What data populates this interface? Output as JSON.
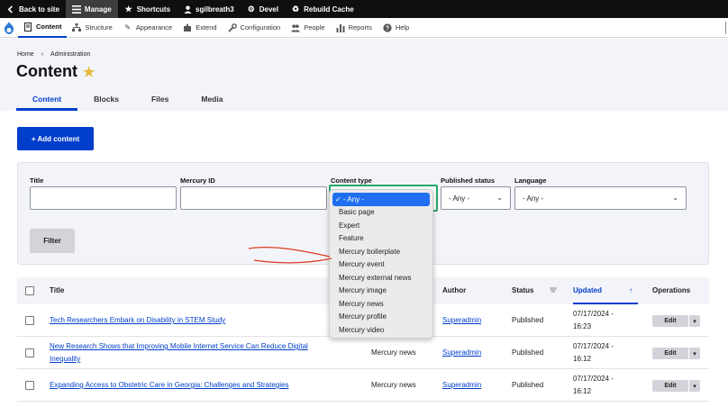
{
  "toolbar": {
    "back": "Back to site",
    "manage": "Manage",
    "shortcuts": "Shortcuts",
    "user": "sgilbreath3",
    "devel": "Devel",
    "rebuild": "Rebuild Cache"
  },
  "tray": {
    "items": [
      "Content",
      "Structure",
      "Appearance",
      "Extend",
      "Configuration",
      "People",
      "Reports",
      "Help"
    ]
  },
  "breadcrumb": [
    "Home",
    "›",
    "Administration"
  ],
  "page_title": "Content",
  "tabs": [
    "Content",
    "Blocks",
    "Files",
    "Media"
  ],
  "add_content": "+ Add content",
  "filters": {
    "title_label": "Title",
    "mercury_id_label": "Mercury ID",
    "content_type_label": "Content type",
    "published_label": "Published status",
    "published_value": "- Any -",
    "language_label": "Language",
    "language_value": "- Any -",
    "filter_button": "Filter"
  },
  "dropdown": {
    "options": [
      "✓ - Any -",
      "Basic page",
      "Expert",
      "Feature",
      "Mercury boilerplate",
      "Mercury event",
      "Mercury external news",
      "Mercury image",
      "Mercury news",
      "Mercury profile",
      "Mercury video"
    ]
  },
  "table": {
    "headers": {
      "title": "Title",
      "author": "Author",
      "status": "Status",
      "updated": "Updated",
      "operations": "Operations"
    },
    "sort_icon": "↑",
    "rows": [
      {
        "title": "Tech Researchers Embark on Disability in STEM Study",
        "type": "",
        "author": "Superadmin",
        "status": "Published",
        "updated_date": "07/17/2024 -",
        "updated_time": "16:23",
        "edit": "Edit"
      },
      {
        "title_line1": "New Research Shows that Improving Mobile Internet Service Can Reduce Digital",
        "title_line2": "Inequality",
        "type": "Mercury news",
        "author": "Superadmin",
        "status": "Published",
        "updated_date": "07/17/2024 -",
        "updated_time": "16:12",
        "edit": "Edit"
      },
      {
        "title": "Expanding Access to Obstetric Care in Georgia: Challenges and Strategies",
        "type": "Mercury news",
        "author": "Superadmin",
        "status": "Published",
        "updated_date": "07/17/2024 -",
        "updated_time": "16:12",
        "edit": "Edit"
      }
    ]
  },
  "colors": {
    "accent": "#003ecc",
    "toolbar_bg": "#0f0f0f",
    "header_bg": "#f3f4f9",
    "select_focus": "#26a769",
    "option_selected": "#1f6ff0",
    "annotation": "#e03a22"
  }
}
